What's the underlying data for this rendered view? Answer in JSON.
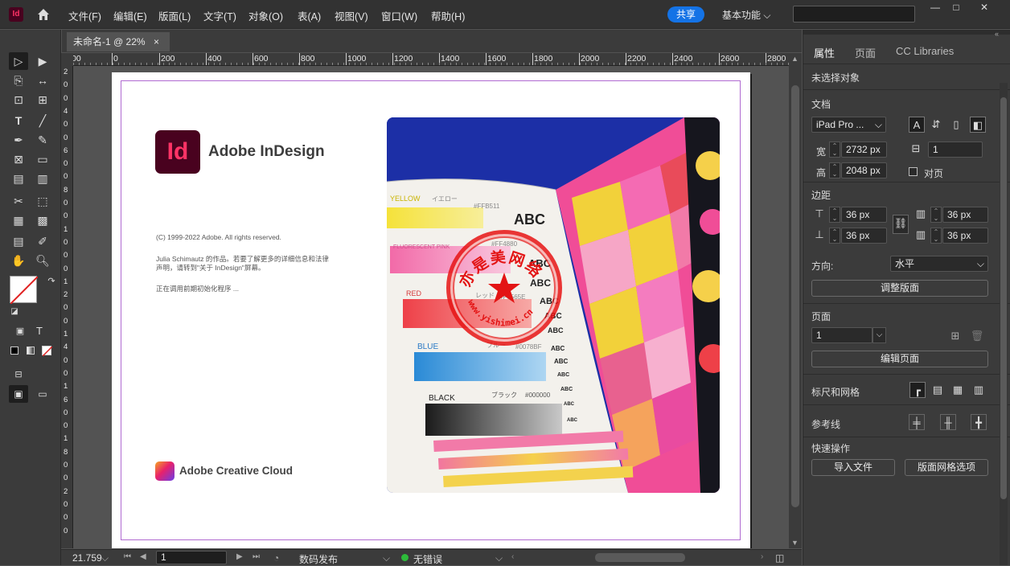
{
  "app": {
    "logo_text": "Id"
  },
  "menu": [
    "文件(F)",
    "编辑(E)",
    "版面(L)",
    "文字(T)",
    "对象(O)",
    "表(A)",
    "视图(V)",
    "窗口(W)",
    "帮助(H)"
  ],
  "header": {
    "share_label": "共享",
    "workspace_label": "基本功能",
    "search_placeholder": ""
  },
  "document_tab": {
    "title": "未命名-1 @ 22%",
    "close": "×"
  },
  "rulers": {
    "h_ticks": [
      "00",
      "0",
      "200",
      "400",
      "600",
      "800",
      "1000",
      "1200",
      "1400",
      "1600",
      "1800",
      "2000",
      "2200",
      "2400",
      "2600",
      "2800"
    ],
    "v_ticks": [
      "2",
      "0",
      "0",
      "4",
      "0",
      "0",
      "6",
      "0",
      "0",
      "8",
      "0",
      "0",
      "1",
      "0",
      "0",
      "0",
      "1",
      "2",
      "0",
      "0",
      "1",
      "4",
      "0",
      "0",
      "1",
      "6",
      "0",
      "0",
      "1",
      "8",
      "0",
      "0",
      "2",
      "0",
      "0",
      "0"
    ]
  },
  "splash": {
    "logo_text": "Id",
    "product_name": "Adobe InDesign",
    "copyright": "(C) 1999-2022 Adobe. All rights reserved.",
    "credit_line1": "Julia Schimautz 的作品。若要了解更多的详细信息和法律",
    "credit_line2": "声明，请转到\"关于 InDesign\"屏幕。",
    "status": "正在调用前期初始化程序 ...",
    "cc_name": "Adobe Creative Cloud"
  },
  "artwork": {
    "labels": [
      "YELLOW",
      "イエロー",
      "#FFB511",
      "ABC",
      "FLUORESCENT PINK",
      "#FF4880",
      "RED",
      "レッド",
      "#F6565E",
      "BLUE",
      "ブルー",
      "#0078BF",
      "BLACK",
      "ブラック",
      "#000000",
      "ABC",
      "ABC",
      "ABC",
      "ABC",
      "ABC",
      "ABC",
      "ABC",
      "ABC",
      "ABC",
      "ABC",
      "ABC"
    ],
    "stamp_top": "亦是美网络",
    "stamp_url": "www.yishimei.cn",
    "stamp_side": "中国"
  },
  "panel": {
    "tabs": [
      "属性",
      "页面",
      "CC Libraries"
    ],
    "no_selection": "未选择对象",
    "doc_section": "文档",
    "preset": "iPad Pro ...",
    "width_label": "宽",
    "width_value": "2732 px",
    "height_label": "高",
    "height_value": "2048 px",
    "pages_value": "1",
    "facing_label": "对页",
    "margins_section": "边距",
    "margin_top": "36 px",
    "margin_bottom": "36 px",
    "margin_left": "36 px",
    "margin_right": "36 px",
    "orientation_label": "方向:",
    "orientation_value": "水平",
    "adjust_layout": "调整版面",
    "pages_section": "页面",
    "page_value": "1",
    "edit_page": "编辑页面",
    "rulers_grids": "标尺和网格",
    "guides": "参考线",
    "quick_actions": "快速操作",
    "import_file": "导入文件",
    "layout_grid_options": "版面网格选项"
  },
  "status": {
    "zoom": "21.759",
    "page": "1",
    "profile": "数码发布",
    "errors": "无错误"
  },
  "colors": {
    "accent": "#1473e6",
    "id_brand": "#49021f",
    "id_pink": "#ff3366",
    "margin_guide": "#b06ad1",
    "stamp_red": "#e31414"
  }
}
